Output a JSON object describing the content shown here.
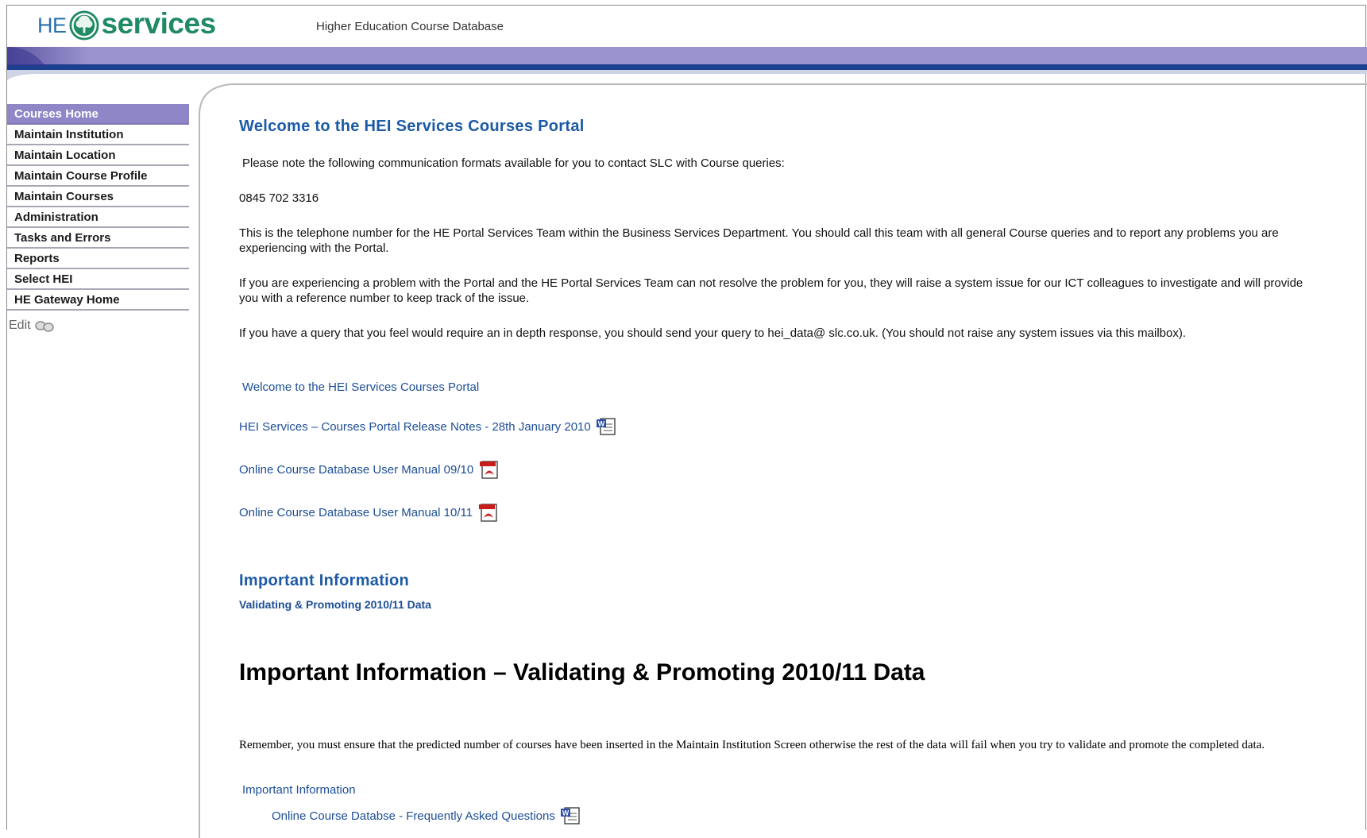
{
  "header": {
    "logo_he": "HE",
    "logo_services": "services",
    "subtitle": "Higher Education Course Database"
  },
  "colors": {
    "banner_purple": "#9a93cf",
    "banner_blue": "#1d3f8f",
    "nav_active": "#8e86c6",
    "link_blue": "#1c4e96",
    "heading_blue": "#1c5aa6",
    "logo_green": "#1f8a63"
  },
  "sidebar": {
    "items": [
      {
        "label": "Courses Home",
        "active": true
      },
      {
        "label": "Maintain Institution"
      },
      {
        "label": "Maintain Location"
      },
      {
        "label": "Maintain Course Profile"
      },
      {
        "label": "Maintain Courses"
      },
      {
        "label": "Administration"
      },
      {
        "label": "Tasks and Errors"
      },
      {
        "label": "Reports"
      },
      {
        "label": "Select HEI"
      },
      {
        "label": "HE Gateway Home"
      }
    ],
    "edit_label": "Edit"
  },
  "main": {
    "title": "Welcome to the HEI Services Courses Portal",
    "intro": "Please note the following communication formats available for you to contact SLC with Course queries:",
    "phone": "0845 702 3316",
    "para1": "This is the telephone number for the HE Portal Services Team within the Business Services Department. You should call this team with all general Course queries and to report any problems you are experiencing with the Portal.",
    "para2": "If you are experiencing a problem with the Portal and the HE Portal Services Team can not resolve the problem for you, they will raise a system issue for our ICT colleagues to investigate and will provide you with a reference number to keep track of the issue.",
    "para3": "If you have a query that you feel would require an in depth response, you should send your query to hei_data@ slc.co.uk.  (You should not raise any system issues via this mailbox).",
    "links": [
      {
        "label": "Welcome to the HEI Services Courses Portal",
        "icon": "none"
      },
      {
        "label": "HEI Services – Courses Portal Release Notes - 28th January 2010",
        "icon": "word-doc-icon"
      },
      {
        "label": "Online Course Database User Manual 09/10",
        "icon": "pdf-icon"
      },
      {
        "label": "Online Course Database User Manual 10/11",
        "icon": "pdf-icon"
      }
    ],
    "important_heading": "Important Information",
    "important_link": "Validating & Promoting 2010/11 Data",
    "big_heading": "Important Information – Validating & Promoting 2010/11 Data",
    "reminder": "Remember,  you must ensure that the predicted number of courses have been inserted in the Maintain Institution Screen otherwise the rest of the data will fail when you try to validate and promote the completed data.",
    "bottom_link1": "Important Information",
    "bottom_link2": "Online Course Databse - Frequently Asked Questions"
  }
}
